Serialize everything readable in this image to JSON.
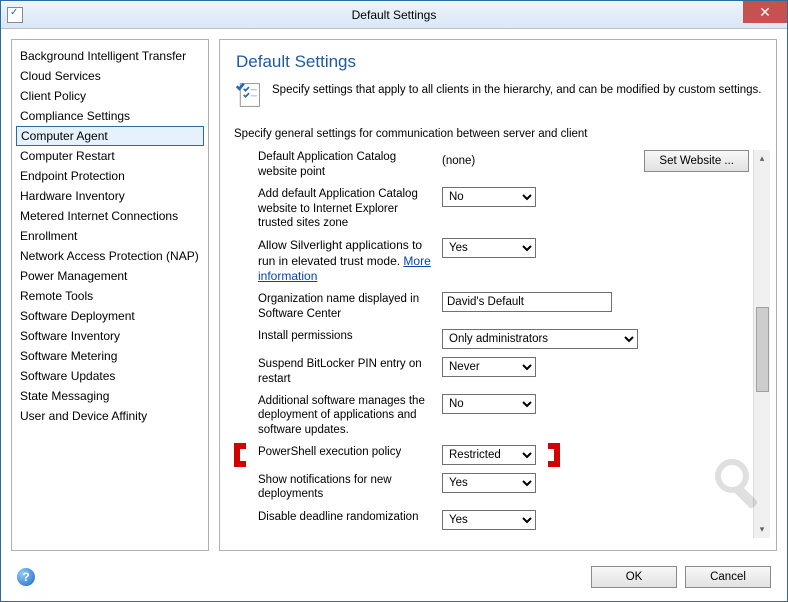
{
  "window": {
    "title": "Default Settings"
  },
  "sidebar": {
    "items": [
      "Background Intelligent Transfer",
      "Cloud Services",
      "Client Policy",
      "Compliance Settings",
      "Computer Agent",
      "Computer Restart",
      "Endpoint Protection",
      "Hardware Inventory",
      "Metered Internet Connections",
      "Enrollment",
      "Network Access Protection (NAP)",
      "Power Management",
      "Remote Tools",
      "Software Deployment",
      "Software Inventory",
      "Software Metering",
      "Software Updates",
      "State Messaging",
      "User and Device Affinity"
    ],
    "selected_index": 4
  },
  "main": {
    "heading": "Default Settings",
    "subtitle": "Specify settings that apply to all clients in the hierarchy, and can be modified by custom settings.",
    "section_label": "Specify general settings for communication between server and client",
    "rows": {
      "catalog_point": {
        "label": "Default Application Catalog website point",
        "value": "(none)",
        "button": "Set Website ..."
      },
      "trusted_zone": {
        "label": "Add default Application Catalog website to Internet Explorer trusted sites zone",
        "value": "No"
      },
      "silverlight": {
        "label_a": "Allow Silverlight applications to run in elevated trust mode. ",
        "link": "More information",
        "value": "Yes"
      },
      "org_name": {
        "label": "Organization name displayed in Software Center",
        "value": "David's Default"
      },
      "install_perm": {
        "label": "Install permissions",
        "value": "Only administrators"
      },
      "bitlocker": {
        "label": "Suspend BitLocker PIN entry on restart",
        "value": "Never"
      },
      "addl_software": {
        "label": "Additional software manages the deployment of applications and software updates.",
        "value": "No"
      },
      "powershell": {
        "label": "PowerShell execution policy",
        "value": "Restricted"
      },
      "notifications": {
        "label": "Show notifications for new deployments",
        "value": "Yes"
      },
      "deadline": {
        "label": "Disable deadline randomization",
        "value": "Yes"
      }
    }
  },
  "footer": {
    "ok": "OK",
    "cancel": "Cancel"
  }
}
